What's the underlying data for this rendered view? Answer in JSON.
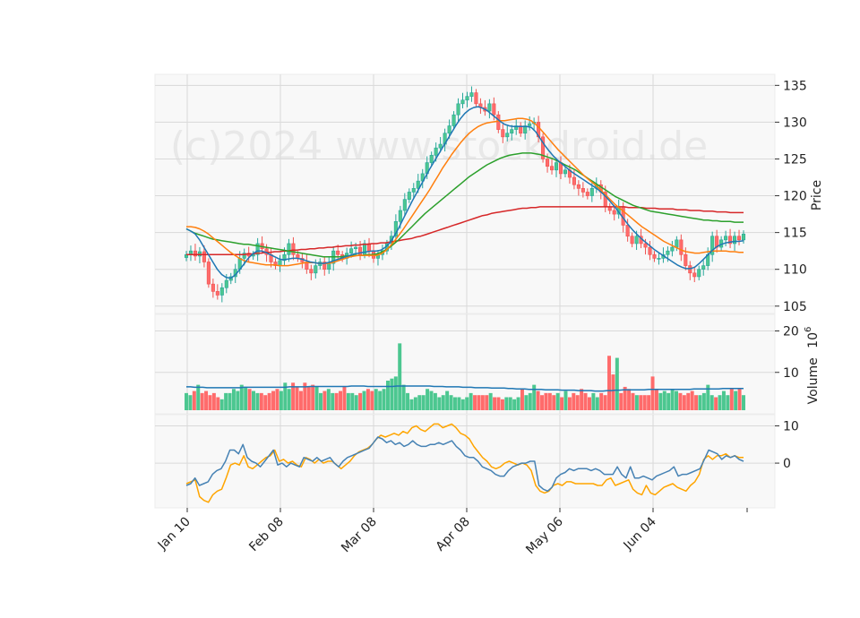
{
  "chart_data": {
    "type": "candlestick",
    "watermark": "(c)2024 www.stockdroid.de",
    "x_ticks": [
      "Jan 10",
      "Feb 08",
      "Mar 08",
      "Apr 08",
      "May 06",
      "Jun 04"
    ],
    "colors": {
      "up": "#26a69a",
      "down": "#ef5350",
      "up_fill": "#4cc790",
      "down_fill": "#ff6b6b",
      "ma_fast": "#1f77b4",
      "ma_mid": "#ff7f0e",
      "ma_slow": "#2ca02c",
      "ma_long": "#d62728",
      "vol_ma": "#1f77b4",
      "osc_a": "#4682b4",
      "osc_b": "#ffa500"
    },
    "price_panel": {
      "ylabel": "Price",
      "ylim": [
        104,
        136.5
      ],
      "yticks": [
        105,
        110,
        115,
        120,
        125,
        130,
        135
      ],
      "closes": [
        112.0,
        112.5,
        111.8,
        112.4,
        111.0,
        108.0,
        107.0,
        106.5,
        107.5,
        108.5,
        109.0,
        110.0,
        111.5,
        112.2,
        111.8,
        112.0,
        113.5,
        112.8,
        112.0,
        111.0,
        110.5,
        111.2,
        112.0,
        113.5,
        112.0,
        111.5,
        111.0,
        110.0,
        109.5,
        110.5,
        111.0,
        110.0,
        110.8,
        112.5,
        112.0,
        111.5,
        112.2,
        112.8,
        113.0,
        112.0,
        113.5,
        112.5,
        111.5,
        112.0,
        112.5,
        113.5,
        114.5,
        116.5,
        118.0,
        119.5,
        120.5,
        121.0,
        122.0,
        123.0,
        124.5,
        125.5,
        126.5,
        127.0,
        128.5,
        129.5,
        131.0,
        132.5,
        133.0,
        133.5,
        134.0,
        132.5,
        132.0,
        131.5,
        132.5,
        131.0,
        129.0,
        128.0,
        128.5,
        129.0,
        129.5,
        128.5,
        129.5,
        129.8,
        130.0,
        128.0,
        125.0,
        124.0,
        123.5,
        124.5,
        123.0,
        123.5,
        122.5,
        121.5,
        121.0,
        120.5,
        120.0,
        121.0,
        121.5,
        120.5,
        118.5,
        118.0,
        117.5,
        118.5,
        116.0,
        114.5,
        113.5,
        114.5,
        113.5,
        113.0,
        112.0,
        111.5,
        111.5,
        112.0,
        112.5,
        113.0,
        114.0,
        112.0,
        110.5,
        109.5,
        109.0,
        110.0,
        110.5,
        112.0,
        114.5,
        113.0,
        114.0,
        114.5,
        113.5,
        114.5,
        114.0,
        114.8
      ],
      "ma_fast": [
        115.5,
        115.2,
        114.8,
        114.0,
        113.0,
        112.0,
        111.0,
        110.0,
        109.3,
        108.9,
        108.8,
        109.2,
        109.9,
        110.7,
        111.5,
        112.1,
        112.5,
        112.5,
        112.3,
        112.0,
        111.7,
        111.4,
        111.3,
        111.4,
        111.5,
        111.5,
        111.4,
        111.2,
        111.0,
        110.9,
        110.8,
        110.8,
        110.9,
        111.1,
        111.3,
        111.5,
        111.7,
        111.9,
        112.1,
        112.2,
        112.3,
        112.4,
        112.5,
        112.5,
        112.6,
        113.0,
        113.6,
        114.5,
        115.6,
        116.8,
        118.0,
        119.2,
        120.3,
        121.4,
        122.5,
        123.6,
        124.6,
        125.6,
        126.6,
        127.6,
        128.6,
        129.6,
        130.5,
        131.2,
        131.7,
        132.0,
        132.1,
        131.9,
        131.6,
        131.1,
        130.6,
        130.1,
        129.7,
        129.5,
        129.4,
        129.4,
        129.4,
        129.4,
        129.3,
        128.7,
        127.8,
        126.9,
        126.1,
        125.4,
        124.8,
        124.3,
        123.8,
        123.3,
        122.9,
        122.5,
        122.1,
        121.7,
        121.3,
        120.9,
        120.4,
        119.8,
        119.1,
        118.4,
        117.6,
        116.8,
        116.0,
        115.3,
        114.7,
        114.1,
        113.6,
        113.1,
        112.6,
        112.2,
        111.8,
        111.4,
        111.0,
        110.6,
        110.3,
        110.1,
        110.1,
        110.3,
        110.8,
        111.4,
        112.0,
        112.6,
        113.1,
        113.4,
        113.6,
        113.7,
        113.8,
        113.8,
        113.9
      ],
      "ma_mid": [
        115.8,
        115.8,
        115.7,
        115.5,
        115.2,
        114.8,
        114.3,
        113.8,
        113.3,
        112.8,
        112.3,
        111.9,
        111.5,
        111.2,
        111.0,
        110.9,
        110.8,
        110.7,
        110.6,
        110.6,
        110.6,
        110.5,
        110.5,
        110.5,
        110.6,
        110.7,
        110.8,
        110.9,
        110.9,
        110.9,
        110.8,
        110.8,
        110.8,
        110.9,
        111.1,
        111.3,
        111.5,
        111.7,
        111.8,
        111.9,
        111.9,
        111.9,
        111.9,
        111.9,
        112.1,
        112.5,
        113.1,
        113.8,
        114.6,
        115.4,
        116.3,
        117.2,
        118.1,
        119.0,
        119.9,
        120.8,
        121.8,
        122.8,
        123.8,
        124.7,
        125.6,
        126.4,
        127.2,
        127.9,
        128.5,
        129.0,
        129.4,
        129.7,
        129.9,
        130.0,
        130.1,
        130.2,
        130.2,
        130.3,
        130.4,
        130.5,
        130.5,
        130.4,
        130.2,
        129.7,
        129.1,
        128.4,
        127.7,
        127.0,
        126.3,
        125.7,
        125.1,
        124.5,
        123.9,
        123.3,
        122.7,
        122.2,
        121.7,
        121.2,
        120.6,
        120.0,
        119.4,
        118.8,
        118.3,
        117.8,
        117.3,
        116.8,
        116.3,
        115.8,
        115.4,
        115.0,
        114.6,
        114.2,
        113.8,
        113.5,
        113.2,
        112.9,
        112.6,
        112.4,
        112.3,
        112.2,
        112.2,
        112.3,
        112.4,
        112.5,
        112.5,
        112.5,
        112.5,
        112.4,
        112.4,
        112.3,
        112.3
      ],
      "ma_slow": [
        115.5,
        115.2,
        114.9,
        114.7,
        114.5,
        114.3,
        114.1,
        114.0,
        113.9,
        113.8,
        113.7,
        113.6,
        113.5,
        113.4,
        113.4,
        113.3,
        113.2,
        113.1,
        113.0,
        112.9,
        112.8,
        112.7,
        112.6,
        112.5,
        112.4,
        112.3,
        112.2,
        112.1,
        112.0,
        111.9,
        111.8,
        111.7,
        111.7,
        111.7,
        111.7,
        111.7,
        111.8,
        111.8,
        111.9,
        111.9,
        111.9,
        112.0,
        112.0,
        112.1,
        112.3,
        112.6,
        113.0,
        113.5,
        114.0,
        114.6,
        115.2,
        115.8,
        116.4,
        117.0,
        117.6,
        118.1,
        118.6,
        119.1,
        119.6,
        120.1,
        120.6,
        121.1,
        121.6,
        122.1,
        122.6,
        123.0,
        123.4,
        123.8,
        124.2,
        124.5,
        124.8,
        125.1,
        125.3,
        125.5,
        125.6,
        125.7,
        125.8,
        125.8,
        125.8,
        125.7,
        125.6,
        125.4,
        125.2,
        125.0,
        124.7,
        124.4,
        124.1,
        123.8,
        123.5,
        123.1,
        122.7,
        122.3,
        121.9,
        121.5,
        121.1,
        120.7,
        120.3,
        119.9,
        119.6,
        119.3,
        119.0,
        118.7,
        118.5,
        118.3,
        118.1,
        117.9,
        117.8,
        117.7,
        117.6,
        117.5,
        117.4,
        117.3,
        117.2,
        117.1,
        117.0,
        116.9,
        116.8,
        116.7,
        116.7,
        116.6,
        116.6,
        116.5,
        116.5,
        116.5,
        116.4,
        116.4,
        116.4
      ],
      "ma_long": [
        112.0,
        112.0,
        112.0,
        112.0,
        112.0,
        112.0,
        112.0,
        112.0,
        112.0,
        112.0,
        112.0,
        112.0,
        112.0,
        112.0,
        112.1,
        112.1,
        112.2,
        112.2,
        112.3,
        112.3,
        112.4,
        112.4,
        112.5,
        112.5,
        112.6,
        112.6,
        112.7,
        112.7,
        112.8,
        112.8,
        112.9,
        112.9,
        113.0,
        113.0,
        113.1,
        113.1,
        113.2,
        113.2,
        113.3,
        113.3,
        113.4,
        113.4,
        113.5,
        113.5,
        113.6,
        113.6,
        113.7,
        113.8,
        113.9,
        114.0,
        114.1,
        114.2,
        114.4,
        114.5,
        114.7,
        114.9,
        115.1,
        115.3,
        115.5,
        115.7,
        115.9,
        116.1,
        116.3,
        116.5,
        116.7,
        116.9,
        117.1,
        117.3,
        117.4,
        117.6,
        117.7,
        117.8,
        117.9,
        118.0,
        118.1,
        118.2,
        118.3,
        118.3,
        118.4,
        118.4,
        118.5,
        118.5,
        118.5,
        118.5,
        118.5,
        118.5,
        118.5,
        118.5,
        118.5,
        118.5,
        118.5,
        118.5,
        118.5,
        118.5,
        118.5,
        118.5,
        118.5,
        118.5,
        118.5,
        118.5,
        118.4,
        118.4,
        118.4,
        118.4,
        118.3,
        118.3,
        118.3,
        118.2,
        118.2,
        118.2,
        118.2,
        118.1,
        118.1,
        118.1,
        118.0,
        118.0,
        118.0,
        117.9,
        117.9,
        117.9,
        117.8,
        117.8,
        117.8,
        117.7,
        117.7,
        117.7,
        117.7
      ]
    },
    "volume_panel": {
      "ylabel": "Volume",
      "exponent": "6",
      "ylim": [
        0,
        24
      ],
      "yticks": [
        10,
        20
      ],
      "values": [
        5.0,
        4.5,
        5.5,
        7.0,
        5.0,
        5.5,
        4.5,
        5.0,
        4.0,
        3.5,
        5.0,
        5.0,
        6.0,
        5.5,
        7.0,
        6.5,
        6.0,
        5.5,
        5.0,
        5.0,
        4.5,
        5.0,
        5.5,
        6.0,
        5.5,
        7.5,
        6.0,
        7.5,
        6.5,
        5.5,
        7.5,
        6.5,
        7.0,
        6.5,
        5.0,
        5.5,
        6.0,
        5.0,
        5.0,
        5.5,
        6.5,
        5.0,
        5.0,
        4.5,
        5.0,
        5.5,
        6.0,
        5.5,
        6.0,
        5.5,
        6.0,
        8.0,
        8.5,
        9.0,
        17.0,
        7.0,
        5.0,
        3.5,
        4.0,
        4.5,
        4.5,
        6.0,
        5.5,
        5.0,
        4.0,
        4.5,
        5.5,
        4.5,
        4.0,
        4.0,
        3.5,
        4.0,
        5.0,
        4.5,
        4.5,
        4.5,
        4.5,
        5.0,
        4.0,
        4.0,
        3.5,
        4.0,
        4.0,
        3.5,
        4.0,
        6.0,
        4.5,
        5.0,
        7.0,
        5.5,
        4.5,
        5.0,
        5.0,
        4.5,
        5.0,
        4.0,
        5.5,
        4.0,
        5.0,
        4.5,
        6.0,
        5.0,
        4.0,
        5.0,
        4.0,
        5.0,
        4.5,
        14.0,
        9.5,
        13.5,
        5.0,
        6.5,
        6.0,
        5.0,
        4.5,
        4.5,
        4.5,
        4.5,
        9.0,
        6.0,
        5.0,
        5.5,
        5.0,
        6.0,
        5.5,
        5.0,
        4.5,
        5.0,
        5.5,
        4.5,
        4.5,
        5.0,
        7.0,
        4.5,
        4.0,
        4.5,
        5.5,
        4.5,
        6.0,
        5.5,
        6.0,
        4.5
      ],
      "ma": [
        6.5,
        6.5,
        6.4,
        6.4,
        6.4,
        6.3,
        6.3,
        6.3,
        6.3,
        6.3,
        6.3,
        6.3,
        6.3,
        6.3,
        6.4,
        6.4,
        6.4,
        6.4,
        6.4,
        6.4,
        6.4,
        6.4,
        6.4,
        6.4,
        6.4,
        6.5,
        6.5,
        6.5,
        6.5,
        6.5,
        6.6,
        6.6,
        6.6,
        6.6,
        6.6,
        6.6,
        6.6,
        6.6,
        6.6,
        6.6,
        6.7,
        6.7,
        6.7,
        6.7,
        6.6,
        6.6,
        6.6,
        6.6,
        6.6,
        6.6,
        6.6,
        6.7,
        6.7,
        6.7,
        6.7,
        6.7,
        6.7,
        6.7,
        6.7,
        6.7,
        6.6,
        6.6,
        6.6,
        6.5,
        6.5,
        6.5,
        6.5,
        6.4,
        6.4,
        6.4,
        6.3,
        6.3,
        6.3,
        6.3,
        6.2,
        6.2,
        6.2,
        6.2,
        6.1,
        6.1,
        6.0,
        6.0,
        6.0,
        5.9,
        5.9,
        5.9,
        5.9,
        5.8,
        5.8,
        5.8,
        5.8,
        5.7,
        5.7,
        5.7,
        5.7,
        5.6,
        5.6,
        5.6,
        5.6,
        5.5,
        5.5,
        5.5,
        5.6,
        5.6,
        5.7,
        5.7,
        5.8,
        5.8,
        5.8,
        5.8,
        5.8,
        5.8,
        5.9,
        5.9,
        5.9,
        5.9,
        5.9,
        5.9,
        5.9,
        5.9,
        5.9,
        5.9,
        5.9,
        6.0,
        6.0,
        6.0,
        6.0,
        6.0,
        6.0,
        6.0,
        6.1,
        6.1,
        6.1,
        6.1,
        6.1,
        6.1
      ]
    },
    "osc_panel": {
      "ylim": [
        -12,
        13
      ],
      "yticks": [
        0,
        10
      ],
      "line_a": [
        -6.0,
        -5.5,
        -4.0,
        -6.0,
        -5.5,
        -5.0,
        -3.0,
        -2.0,
        -1.5,
        0.5,
        3.5,
        3.5,
        2.5,
        5.0,
        1.5,
        0.5,
        0.0,
        -1.0,
        0.5,
        2.0,
        3.5,
        -0.5,
        0.0,
        -1.0,
        0.0,
        -0.5,
        -1.0,
        1.5,
        1.0,
        0.5,
        1.5,
        0.5,
        1.0,
        1.5,
        0.0,
        -1.0,
        0.5,
        1.5,
        2.0,
        2.5,
        3.0,
        3.5,
        4.0,
        5.5,
        7.0,
        6.5,
        5.5,
        6.0,
        5.0,
        5.5,
        4.5,
        5.0,
        6.0,
        5.0,
        4.5,
        4.5,
        5.0,
        5.0,
        5.5,
        5.0,
        5.5,
        6.0,
        4.5,
        3.5,
        2.0,
        1.5,
        1.5,
        0.5,
        -1.0,
        -1.5,
        -2.0,
        -3.0,
        -3.5,
        -3.5,
        -2.0,
        -1.0,
        -0.5,
        0.0,
        0.0,
        0.5,
        0.5,
        -6.0,
        -7.0,
        -7.5,
        -6.5,
        -4.0,
        -3.0,
        -2.5,
        -1.5,
        -2.0,
        -1.5,
        -1.5,
        -1.5,
        -2.0,
        -1.5,
        -2.0,
        -3.0,
        -3.0,
        -3.0,
        -1.0,
        -3.0,
        -4.0,
        -1.0,
        -4.0,
        -4.0,
        -3.5,
        -4.0,
        -4.5,
        -3.5,
        -3.0,
        -2.5,
        -2.0,
        -1.0,
        -3.5,
        -3.0,
        -3.0,
        -2.5,
        -2.0,
        -1.5,
        1.0,
        3.5,
        3.0,
        2.5,
        1.0,
        2.0,
        1.5,
        2.0,
        1.0,
        0.5
      ],
      "line_b": [
        -5.5,
        -5.0,
        -4.5,
        -9.0,
        -10.0,
        -10.5,
        -8.5,
        -7.5,
        -7.0,
        -4.0,
        -0.5,
        0.0,
        -0.5,
        2.0,
        -1.0,
        -1.5,
        -0.5,
        0.5,
        1.5,
        2.0,
        3.5,
        0.5,
        1.0,
        0.0,
        0.5,
        -0.5,
        -1.0,
        1.5,
        1.0,
        0.0,
        1.0,
        0.0,
        0.5,
        0.5,
        -0.5,
        -1.5,
        -0.5,
        0.5,
        2.0,
        3.0,
        3.5,
        4.0,
        5.0,
        6.5,
        7.5,
        7.0,
        7.5,
        8.0,
        7.5,
        8.5,
        8.0,
        9.5,
        10.0,
        9.0,
        8.5,
        9.5,
        10.5,
        10.5,
        9.5,
        10.0,
        10.5,
        9.5,
        8.0,
        7.5,
        6.5,
        4.5,
        3.0,
        1.5,
        0.5,
        -1.0,
        -1.5,
        -1.0,
        0.0,
        0.5,
        0.0,
        -0.5,
        0.0,
        -0.5,
        -2.0,
        -6.0,
        -7.5,
        -8.0,
        -7.5,
        -6.0,
        -5.5,
        -6.0,
        -5.0,
        -5.0,
        -5.5,
        -5.5,
        -5.5,
        -5.5,
        -5.5,
        -6.0,
        -6.0,
        -4.5,
        -4.0,
        -6.0,
        -5.5,
        -5.0,
        -4.5,
        -7.0,
        -8.0,
        -8.5,
        -6.0,
        -8.0,
        -8.5,
        -7.5,
        -6.5,
        -6.0,
        -5.5,
        -6.5,
        -7.0,
        -7.5,
        -6.0,
        -5.0,
        -3.0,
        1.0,
        2.0,
        1.0,
        2.0,
        2.0,
        2.5,
        1.5,
        2.0,
        1.5,
        1.5
      ]
    }
  }
}
